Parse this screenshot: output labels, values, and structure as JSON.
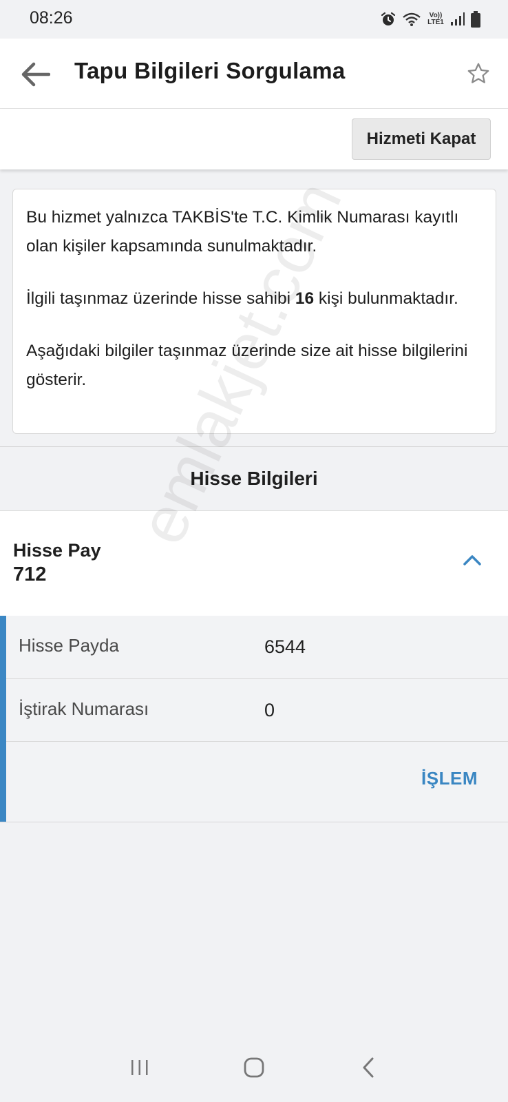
{
  "status_bar": {
    "time": "08:26",
    "network_top": "Vo))",
    "network_bottom": "LTE1",
    "icons": [
      "alarm-icon",
      "wifi-icon",
      "signal-icon",
      "battery-icon"
    ]
  },
  "app_bar": {
    "title": "Tapu Bilgileri Sorgulama",
    "back_icon": "arrow-left-icon",
    "favorite_icon": "star-outline-icon"
  },
  "actions": {
    "close_service_label": "Hizmeti Kapat"
  },
  "info": {
    "paragraph_1": "Bu hizmet yalnızca TAKBİS'te T.C. Kimlik Numarası kayıtlı olan kişiler kapsamında sunulmaktadır.",
    "paragraph_2_prefix": "İlgili taşınmaz üzerinde hisse sahibi ",
    "paragraph_2_count": "16",
    "paragraph_2_suffix": " kişi bulunmaktadır.",
    "paragraph_3": "Aşağıdaki bilgiler taşınmaz üzerinde size ait hisse bilgilerini gösterir."
  },
  "section": {
    "title": "Hisse Bilgileri"
  },
  "share": {
    "label": "Hisse Pay",
    "value": "712",
    "rows": [
      {
        "label": "Hisse Payda",
        "value": "6544"
      },
      {
        "label": "İştirak Numarası",
        "value": "0"
      }
    ],
    "action_label": "İŞLEM"
  },
  "watermark": "emlakjet.com",
  "colors": {
    "accent": "#3b87c4",
    "link": "#3a86c2",
    "background": "#f1f2f4"
  },
  "nav_bar": {
    "icons": [
      "recent-apps-icon",
      "home-icon",
      "back-nav-icon"
    ]
  }
}
